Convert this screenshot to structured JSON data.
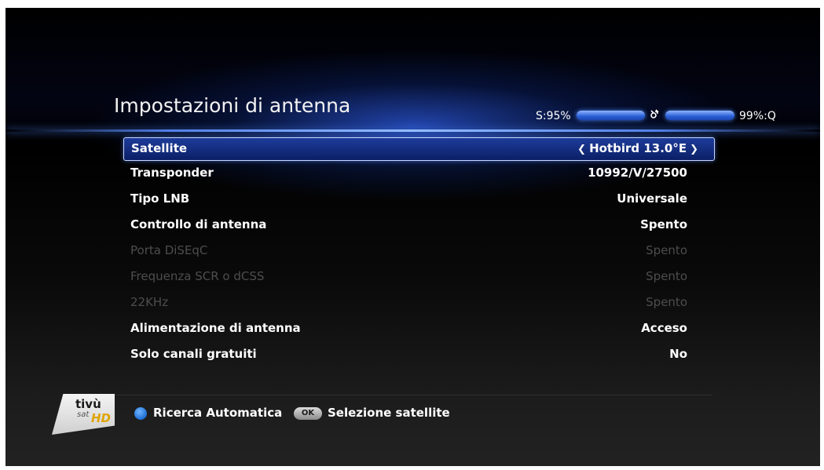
{
  "header": {
    "title": "Impostazioni di antenna",
    "signal_strength_label": "S:95%",
    "signal_quality_label": "99%:Q",
    "signal_strength": 0.95,
    "signal_quality": 0.99,
    "signal_icon": "satellite-icon"
  },
  "settings": [
    {
      "label": "Satellite",
      "value": "Hotbird 13.0°E",
      "state": "selected"
    },
    {
      "label": "Transponder",
      "value": "10992/V/27500",
      "state": "enabled"
    },
    {
      "label": "Tipo LNB",
      "value": "Universale",
      "state": "enabled"
    },
    {
      "label": "Controllo di antenna",
      "value": "Spento",
      "state": "enabled"
    },
    {
      "label": "Porta DiSEqC",
      "value": "Spento",
      "state": "disabled"
    },
    {
      "label": "Frequenza SCR o dCSS",
      "value": "Spento",
      "state": "disabled"
    },
    {
      "label": "22KHz",
      "value": "Spento",
      "state": "disabled"
    },
    {
      "label": "Alimentazione di antenna",
      "value": "Acceso",
      "state": "enabled"
    },
    {
      "label": "Solo canali gratuiti",
      "value": "No",
      "state": "enabled"
    }
  ],
  "footer": {
    "logo_text": {
      "tivu": "tivù",
      "sat": "sat",
      "hd": "HD"
    },
    "blue_key_label": "Ricerca Automatica",
    "ok_key": "OK",
    "ok_key_label": "Selezione satellite"
  },
  "colors": {
    "accent_blue": "#1d3c9a",
    "highlight_border": "#c8d6ff",
    "disabled_text": "#4d4d4d",
    "blue_key": "#1f6fd6"
  }
}
